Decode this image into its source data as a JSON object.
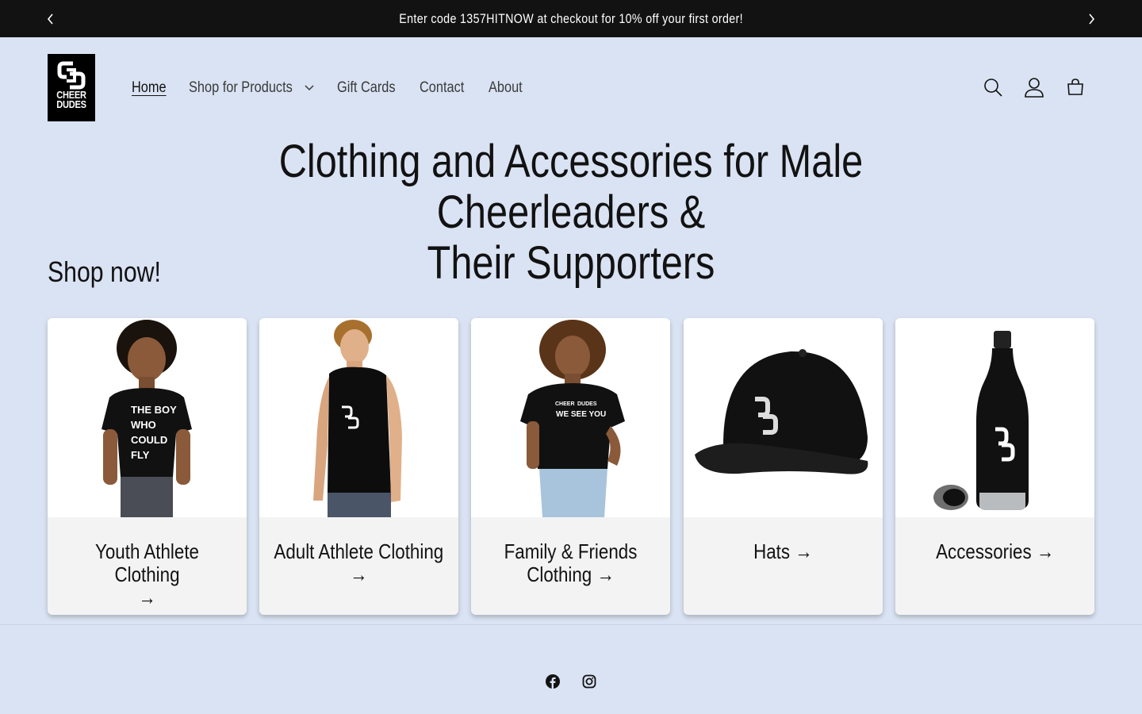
{
  "announcement": {
    "text": "Enter code 1357HITNOW at checkout for 10% off your first order!"
  },
  "logo": {
    "line1": "CHEER",
    "line2": "DUDES"
  },
  "nav": {
    "items": [
      {
        "label": "Home",
        "active": true
      },
      {
        "label": "Shop for Products",
        "dropdown": true
      },
      {
        "label": "Gift Cards"
      },
      {
        "label": "Contact"
      },
      {
        "label": "About"
      }
    ]
  },
  "header_icons": [
    "search-icon",
    "account-icon",
    "cart-icon"
  ],
  "hero": {
    "title_line1": "Clothing and Accessories for Male Cheerleaders &",
    "title_line2": "Their Supporters"
  },
  "shop_now": "Shop now!",
  "collections": [
    {
      "label_line1": "Youth Athlete Clothing",
      "label_line2": "→",
      "shirt_text": [
        "THE BOY",
        "WHO",
        "COULD",
        "FLY"
      ]
    },
    {
      "label_line1": "Adult Athlete Clothing",
      "label_line2": "→"
    },
    {
      "label_line1": "Family & Friends",
      "label_line2": "Clothing →",
      "shirt_text": [
        "CHEER",
        "DUDES",
        "WE SEE YOU"
      ]
    },
    {
      "label_line1": "Hats →",
      "label_line2": ""
    },
    {
      "label_line1": "Accessories →",
      "label_line2": ""
    }
  ],
  "social": [
    "facebook-icon",
    "instagram-icon"
  ],
  "colors": {
    "background": "#dae3f3",
    "announcement_bg": "#121212",
    "card_bg": "#f3f3f3",
    "text": "#121212"
  }
}
